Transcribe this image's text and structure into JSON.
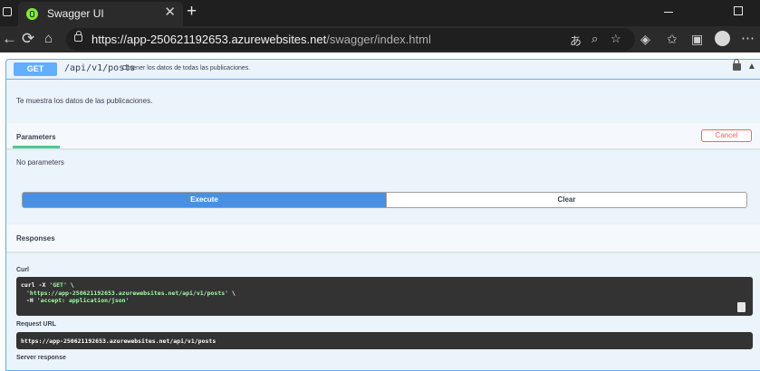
{
  "browser": {
    "tab_title": "Swagger UI",
    "tab_close": "✕",
    "new_tab": "+",
    "url_host": "https://app-250621192653.azurewebsites.net",
    "url_path": "/swagger/index.html"
  },
  "operation": {
    "method": "GET",
    "path": "/api/v1/posts",
    "summary": "Obtener los datos de todas las publicaciones.",
    "description": "Te muestra los datos de las publicaciones."
  },
  "parameters": {
    "tab_label": "Parameters",
    "cancel_label": "Cancel",
    "empty_text": "No parameters"
  },
  "actions": {
    "execute_label": "Execute",
    "clear_label": "Clear"
  },
  "responses": {
    "title": "Responses",
    "curl_label": "Curl",
    "curl_line1_cmd": "curl -X ",
    "curl_line1_method": "'GET'",
    "curl_line1_end": " \\",
    "curl_line2_url": "'https://app-250621192653.azurewebsites.net/api/v1/posts'",
    "curl_line2_end": " \\",
    "curl_line3_flag": "-H ",
    "curl_line3_header": "'accept: application/json'",
    "request_url_label": "Request URL",
    "request_url": "https://app-250621192653.azurewebsites.net/api/v1/posts",
    "server_response_label": "Server response"
  }
}
